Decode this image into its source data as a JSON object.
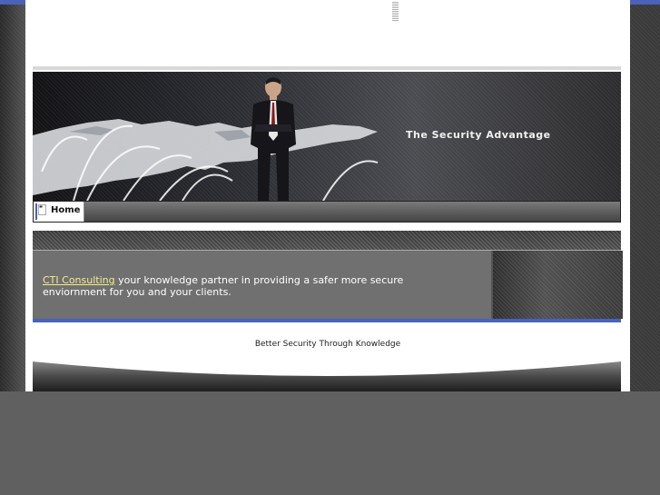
{
  "banner": {
    "tagline": "The Security Advantage"
  },
  "nav": {
    "items": [
      {
        "label": "Home",
        "icon": "page-icon"
      }
    ]
  },
  "content": {
    "link_text": "CTI Consulting",
    "body_text": " your knowledge partner in providing a safer more secure enviornment for you and your clients."
  },
  "footer": {
    "text": "Better Security Through Knowledge"
  },
  "colors": {
    "accent_blue": "#4a62b8",
    "link_yellow": "#f2ec8a",
    "background": "#606060"
  }
}
